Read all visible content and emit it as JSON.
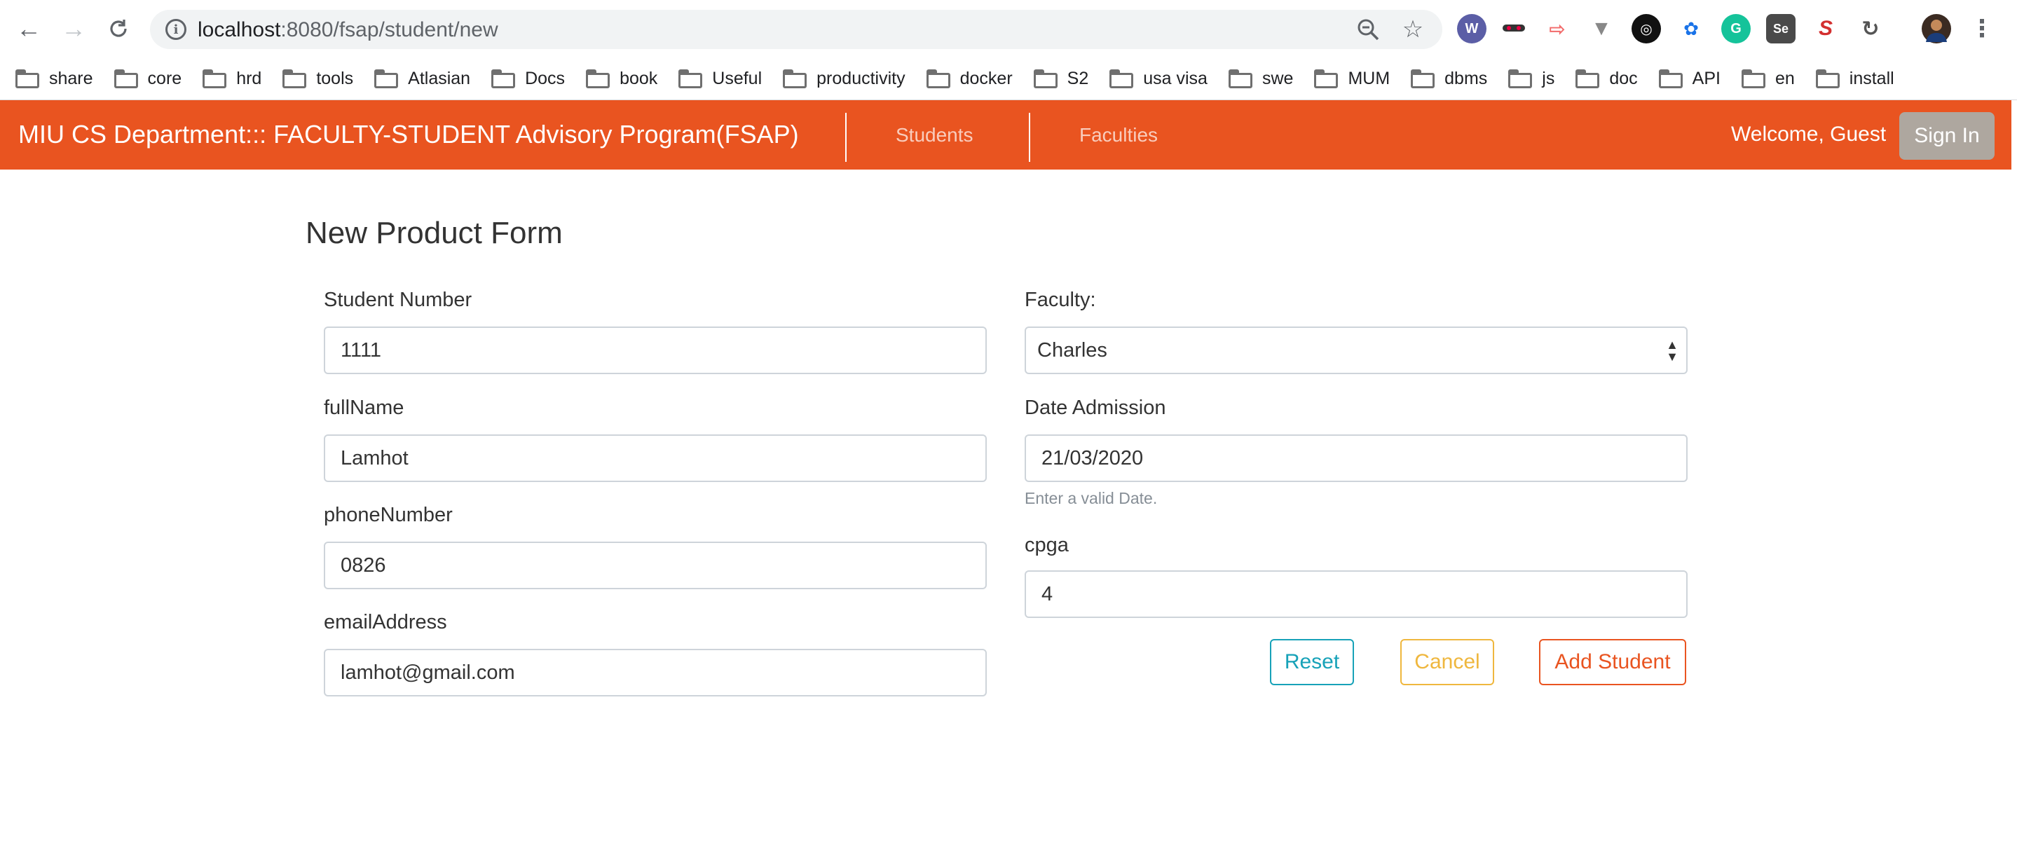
{
  "browser": {
    "url_host": "localhost",
    "url_rest": ":8080/fsap/student/new",
    "bookmarks": [
      "share",
      "core",
      "hrd",
      "tools",
      "Atlasian",
      "Docs",
      "book",
      "Useful",
      "productivity",
      "docker",
      "S2",
      "usa visa",
      "swe",
      "MUM",
      "dbms",
      "js",
      "doc",
      "API",
      "en",
      "install"
    ]
  },
  "navbar": {
    "brand": "MIU CS Department::: FACULTY-STUDENT Advisory Program(FSAP)",
    "links": [
      "Students",
      "Faculties"
    ],
    "welcome": "Welcome, Guest",
    "sign_in": "Sign In"
  },
  "form": {
    "title": "New Product Form",
    "student_number": {
      "label": "Student Number",
      "value": "1111"
    },
    "full_name": {
      "label": "fullName",
      "value": "Lamhot"
    },
    "phone_number": {
      "label": "phoneNumber",
      "value": "0826"
    },
    "email_address": {
      "label": "emailAddress",
      "value": "lamhot@gmail.com"
    },
    "faculty": {
      "label": "Faculty:",
      "value": "Charles"
    },
    "date_admission": {
      "label": "Date Admission",
      "value": "21/03/2020",
      "hint": "Enter a valid Date."
    },
    "cpga": {
      "label": "cpga",
      "value": "4"
    },
    "buttons": {
      "reset": "Reset",
      "cancel": "Cancel",
      "add": "Add Student"
    }
  },
  "colors": {
    "navbar": "#e95420",
    "reset": "#17a2b8",
    "cancel": "#efb73e",
    "add": "#e95420"
  }
}
